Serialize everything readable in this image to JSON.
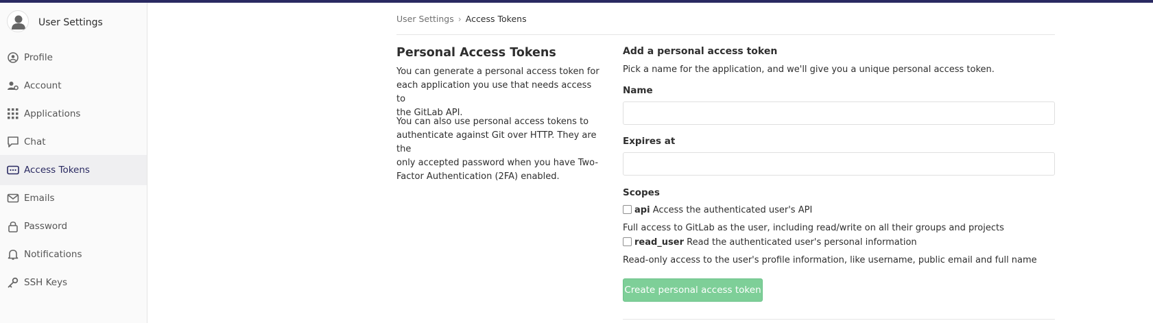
{
  "colors": {
    "topbar": "#292961",
    "active_nav": "#292961",
    "button_bg": "#7ecf98"
  },
  "sidebar": {
    "title": "User Settings",
    "items": [
      {
        "label": "Profile",
        "icon": "profile-icon"
      },
      {
        "label": "Account",
        "icon": "account-icon"
      },
      {
        "label": "Applications",
        "icon": "applications-icon"
      },
      {
        "label": "Chat",
        "icon": "chat-icon"
      },
      {
        "label": "Access Tokens",
        "icon": "token-icon",
        "active": true
      },
      {
        "label": "Emails",
        "icon": "email-icon"
      },
      {
        "label": "Password",
        "icon": "lock-icon"
      },
      {
        "label": "Notifications",
        "icon": "bell-icon"
      },
      {
        "label": "SSH Keys",
        "icon": "key-icon"
      }
    ]
  },
  "breadcrumb": {
    "parent": "User Settings",
    "separator": "›",
    "current": "Access Tokens"
  },
  "left": {
    "title": "Personal Access Tokens",
    "paragraph1_lines": [
      "You can generate a personal access token for",
      "each application you use that needs access to",
      "the GitLab API."
    ],
    "paragraph2_lines": [
      "You can also use personal access tokens to",
      "authenticate against Git over HTTP. They are the",
      "only accepted password when you have Two-",
      "Factor Authentication (2FA) enabled."
    ]
  },
  "form": {
    "heading": "Add a personal access token",
    "description": "Pick a name for the application, and we'll give you a unique personal access token.",
    "name_label": "Name",
    "name_value": "",
    "expires_label": "Expires at",
    "expires_value": "",
    "scopes_label": "Scopes",
    "scopes": [
      {
        "name": "api",
        "title": "Access the authenticated user's API",
        "help": "Full access to GitLab as the user, including read/write on all their groups and projects",
        "checked": false
      },
      {
        "name": "read_user",
        "title": "Read the authenticated user's personal information",
        "help": "Read-only access to the user's profile information, like username, public email and full name",
        "checked": false
      }
    ],
    "submit_label": "Create personal access token"
  }
}
